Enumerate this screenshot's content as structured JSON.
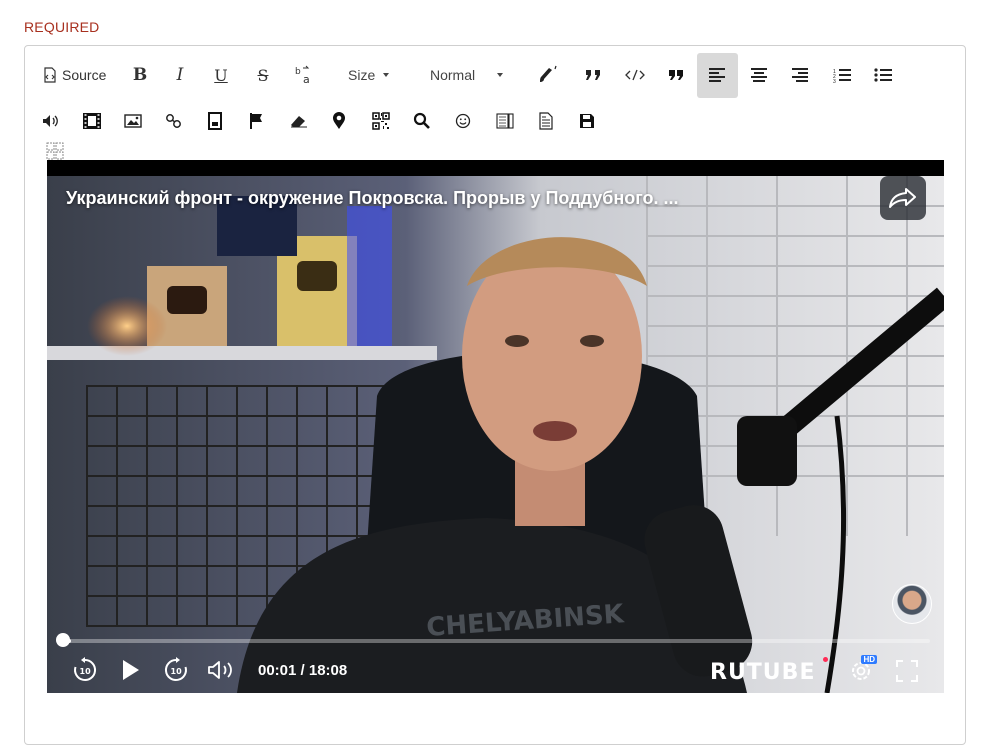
{
  "form": {
    "required_label": "REQUIRED"
  },
  "toolbar": {
    "source_label": "Source",
    "size_label": "Size",
    "format_label": "Normal"
  },
  "video": {
    "title": "Украинский фронт - окружение Покровска. Прорыв у Поддубного. ...",
    "time": "00:01 / 18:08",
    "brand": "RUTUBE",
    "hd_badge": "HD",
    "progress": 0.01
  },
  "colors": {
    "required": "#a8301f",
    "active_button_bg": "#d9d9d9",
    "rutube_dot": "#ff2b55"
  }
}
